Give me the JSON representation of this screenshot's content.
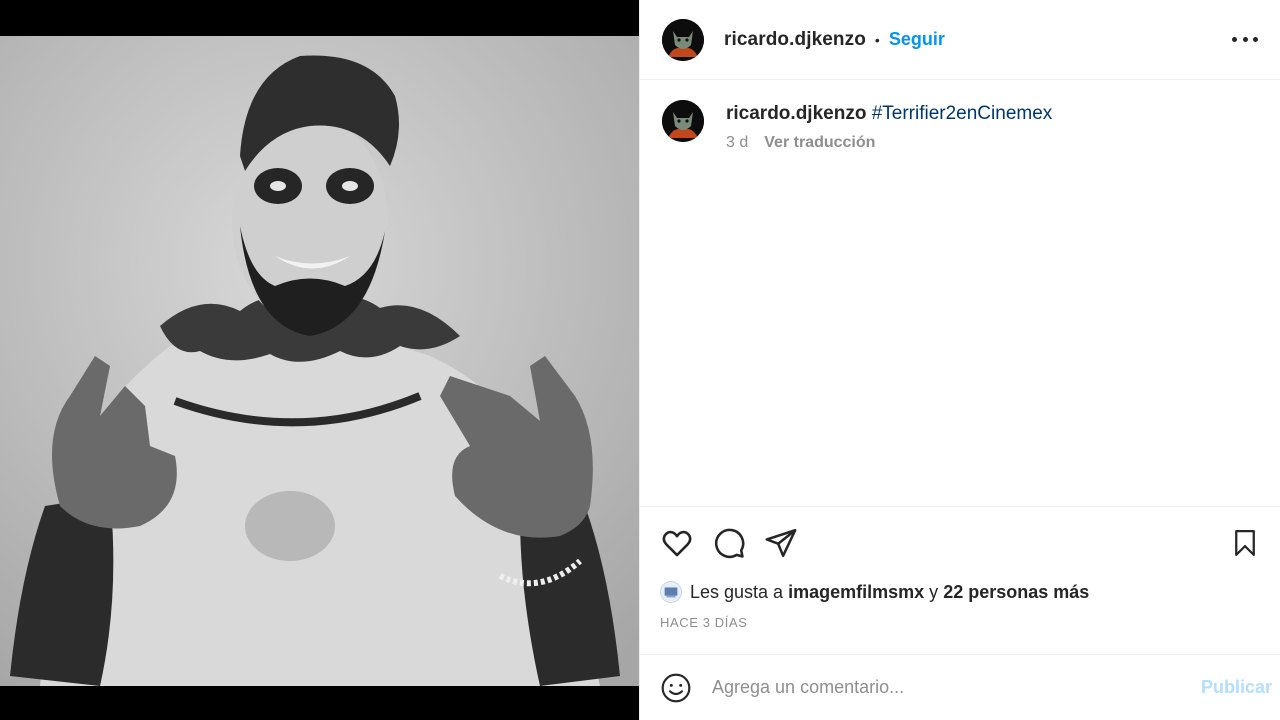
{
  "post": {
    "image_description_icon": "photo-of-person-in-clown-makeup"
  },
  "header": {
    "username": "ricardo.djkenzo",
    "separator": "•",
    "follow_label": "Seguir",
    "more_icon": "more-horizontal-icon"
  },
  "caption": {
    "username": "ricardo.djkenzo",
    "hashtag": "#Terrifier2enCinemex",
    "age": "3 d",
    "translate_label": "Ver traducción"
  },
  "actions": {
    "like_icon": "heart-icon",
    "comment_icon": "comment-icon",
    "share_icon": "send-icon",
    "save_icon": "bookmark-icon"
  },
  "likes": {
    "prefix": "Les gusta a",
    "liker": "imagemfilmsmx",
    "joiner": "y",
    "others": "22 personas más"
  },
  "timestamp": "HACE 3 DÍAS",
  "comment": {
    "placeholder": "Agrega un comentario...",
    "publish_label": "Publicar",
    "emoji_icon": "smiley-icon"
  },
  "colors": {
    "accent": "#0095f6",
    "publish_disabled": "#b2dffc",
    "hashtag": "#00376b",
    "muted": "#8e8e8e"
  }
}
